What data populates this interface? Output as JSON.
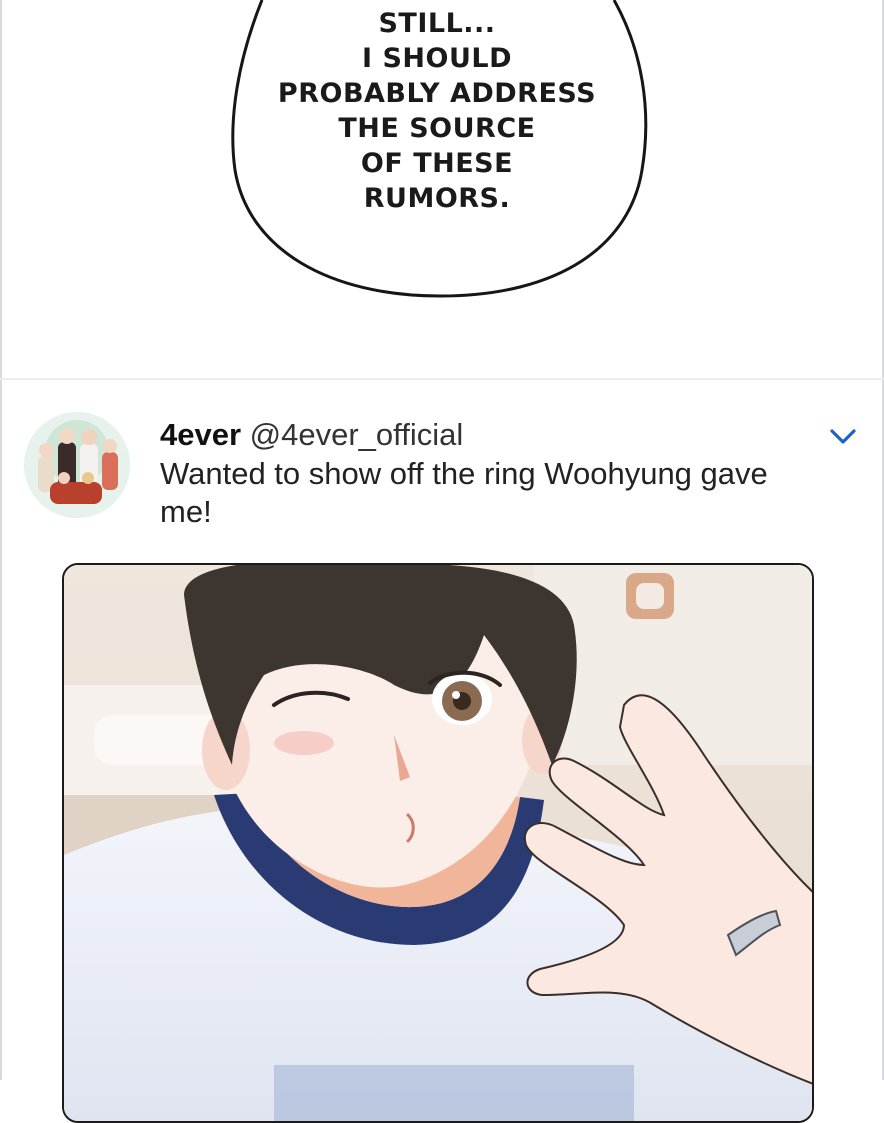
{
  "speech_bubble": {
    "lines": [
      "STILL...",
      "I SHOULD",
      "PROBABLY ADDRESS",
      "THE SOURCE",
      "OF THESE",
      "RUMORS."
    ]
  },
  "tweet": {
    "display_name": "4ever",
    "handle": "@4ever_official",
    "text": "Wanted to show off the ring Woohyung gave me!",
    "avatar_icon": "group-avatar-icon",
    "menu_icon": "chevron-down-icon"
  },
  "colors": {
    "accent": "#1d62c9",
    "text": "#222222",
    "divider": "#ececec",
    "shirt_collar": "#2a3a73"
  }
}
